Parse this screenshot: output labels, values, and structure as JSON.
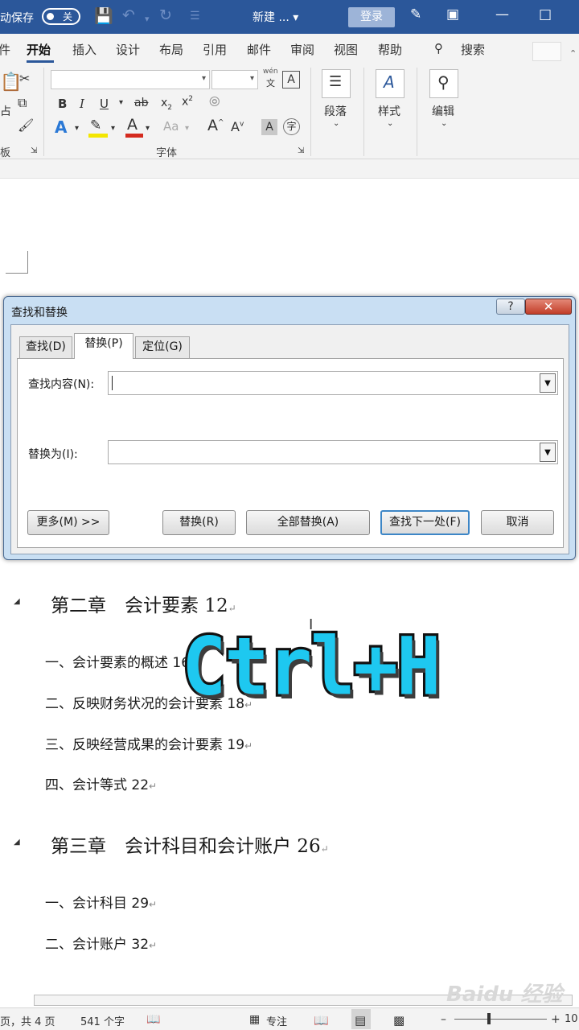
{
  "titlebar": {
    "autosave_label": "动保存",
    "autosave_state": "关",
    "doc_name": "新建 ... ▾",
    "signin_label": "登录"
  },
  "ribbon_tabs": [
    "件",
    "开始",
    "插入",
    "设计",
    "布局",
    "引用",
    "邮件",
    "审阅",
    "视图",
    "帮助"
  ],
  "tell_me": "搜索",
  "ribbon": {
    "clipboard_fragment": "占",
    "clipboard_label": "板",
    "font_size_hint": "wén",
    "font_group_label": "字体",
    "paragraph_label": "段落",
    "styles_label": "样式",
    "editing_label": "编辑"
  },
  "dialog": {
    "title": "查找和替换",
    "help": "?",
    "tabs": [
      "查找(D)",
      "替换(P)",
      "定位(G)"
    ],
    "find_label": "查找内容(N):",
    "find_value": "",
    "replace_label": "替换为(I):",
    "replace_value": "",
    "more_button": "更多(M) >>",
    "replace_button": "替换(R)",
    "replace_all_button": "全部替换(A)",
    "find_next_button": "查找下一处(F)",
    "cancel_button": "取消"
  },
  "document": {
    "chapter2": "第二章　会计要素 12",
    "ch2_items": [
      "一、会计要素的概述 16",
      "二、反映财务状况的会计要素 18",
      "三、反映经营成果的会计要素 19",
      "四、会计等式 22"
    ],
    "chapter3": "第三章　会计科目和会计账户 26",
    "ch3_items": [
      "一、会计科目 29",
      "二、会计账户 32"
    ]
  },
  "overlay_text": "Ctrl+H",
  "watermark": "Baidu 经验",
  "statusbar": {
    "page": "页，共 4 页",
    "words": "541 个字",
    "focus": "专注",
    "zoom": "10"
  },
  "colors": {
    "titlebar": "#2b579a",
    "overlay_fill": "#1ec8f0",
    "dialog_frame": "#c9dff3",
    "close_button": "#c13d28"
  }
}
